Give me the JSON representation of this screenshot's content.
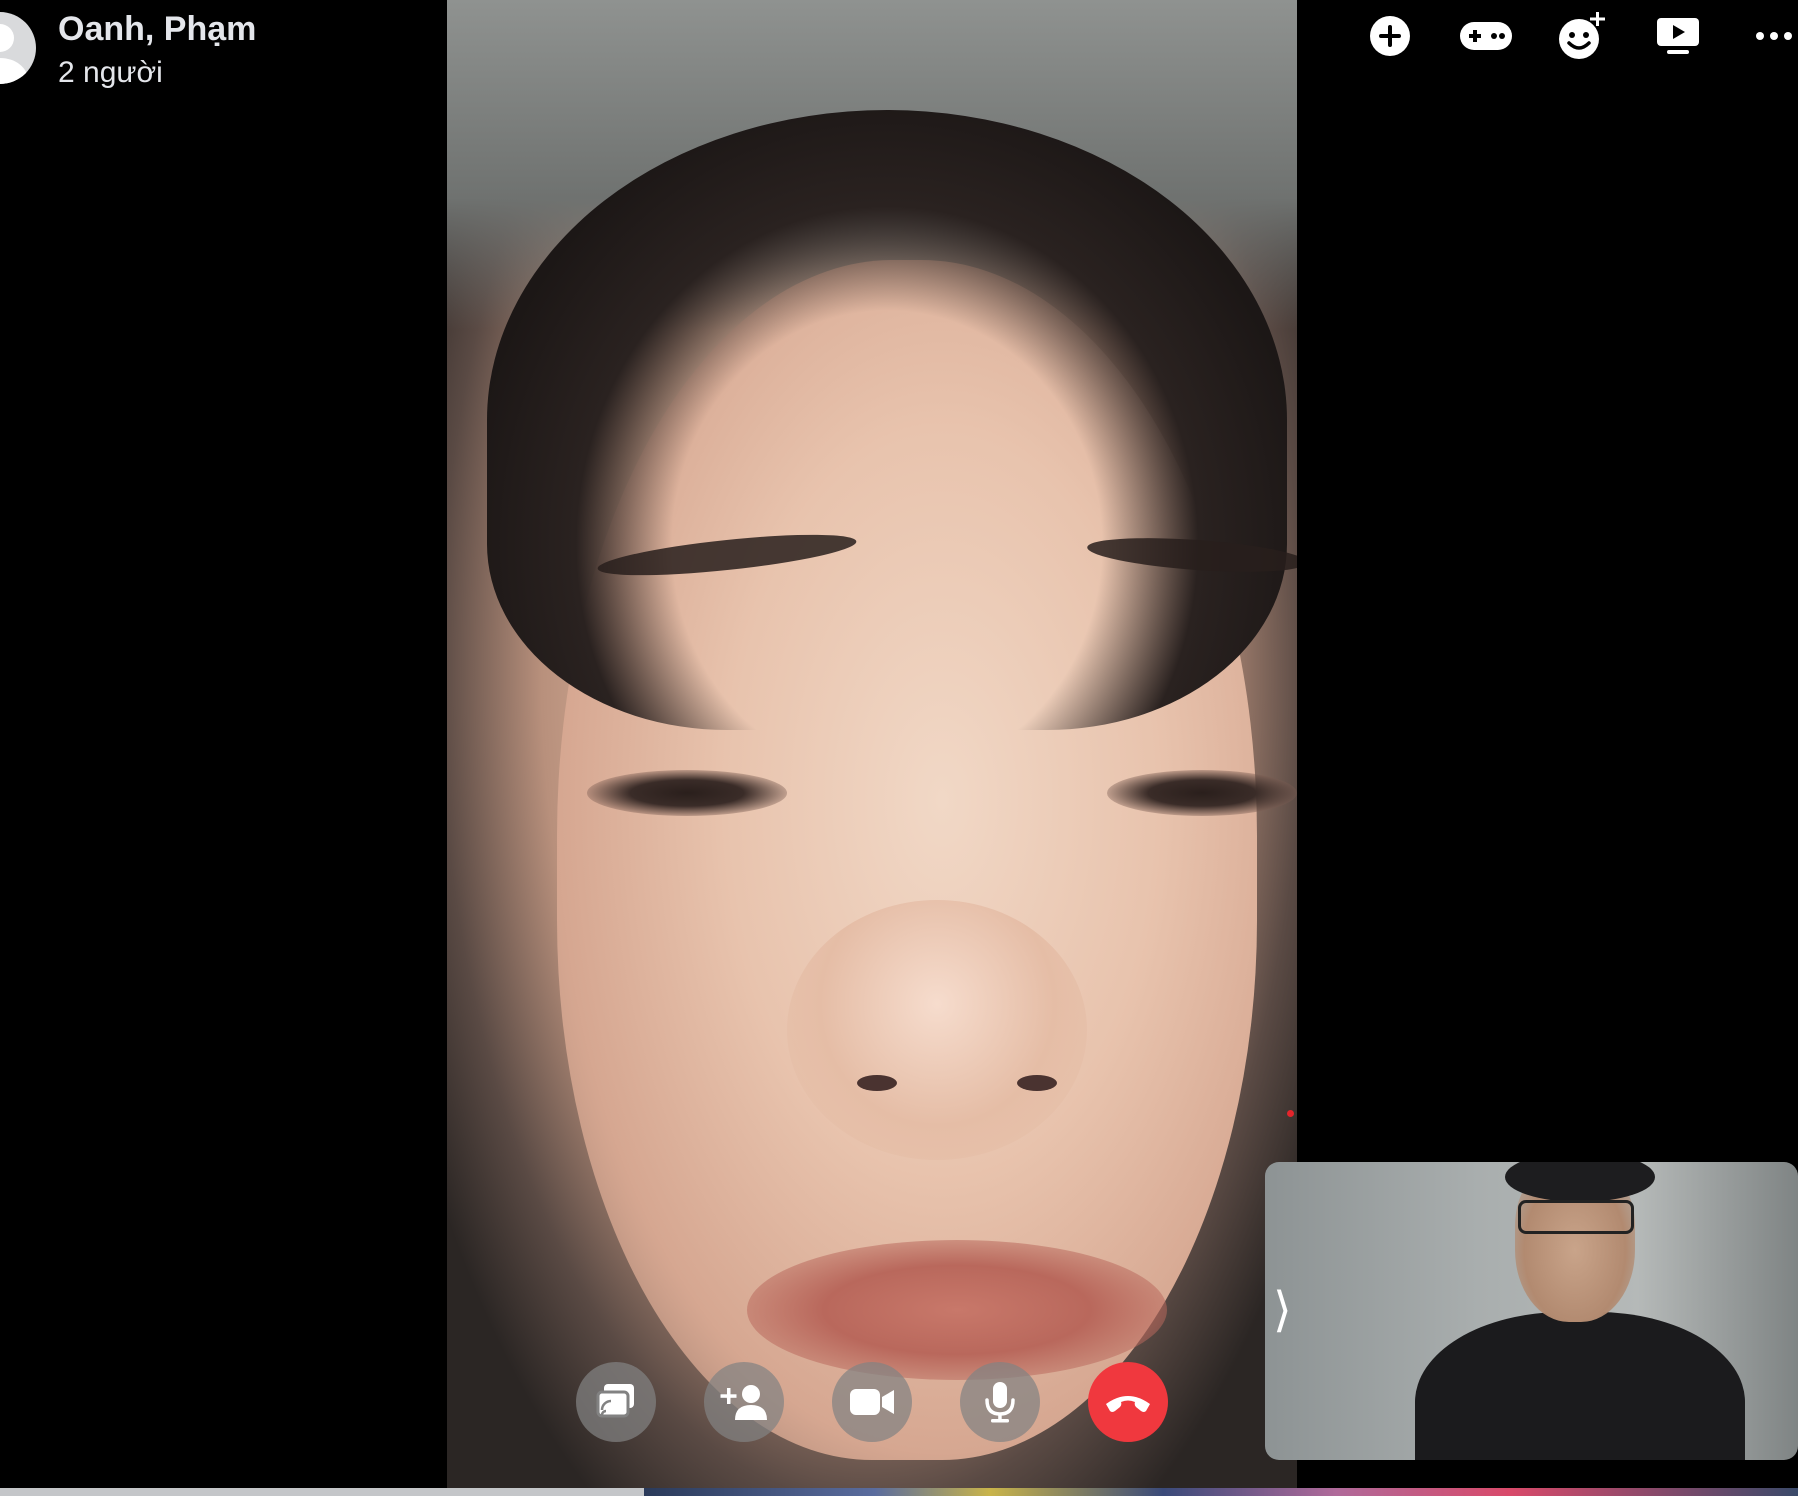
{
  "call": {
    "title": "Oanh, Phạm",
    "subtitle": "2 người"
  },
  "top_actions": [
    {
      "icon": "add-circle-icon"
    },
    {
      "icon": "game-controller-icon"
    },
    {
      "icon": "add-effect-icon"
    },
    {
      "icon": "watch-together-icon"
    },
    {
      "icon": "more-options-icon"
    }
  ],
  "controls": [
    {
      "icon": "share-screen-icon"
    },
    {
      "icon": "add-person-icon"
    },
    {
      "icon": "video-camera-icon"
    },
    {
      "icon": "microphone-icon"
    },
    {
      "icon": "end-call-icon"
    }
  ],
  "self_view": {
    "toggle_icon": "chevron-right-icon",
    "toggle_glyph": "⟩"
  },
  "colors": {
    "background": "#000000",
    "end_call": "#f0383e",
    "control_button": "#828282",
    "text": "#e4e6eb"
  }
}
